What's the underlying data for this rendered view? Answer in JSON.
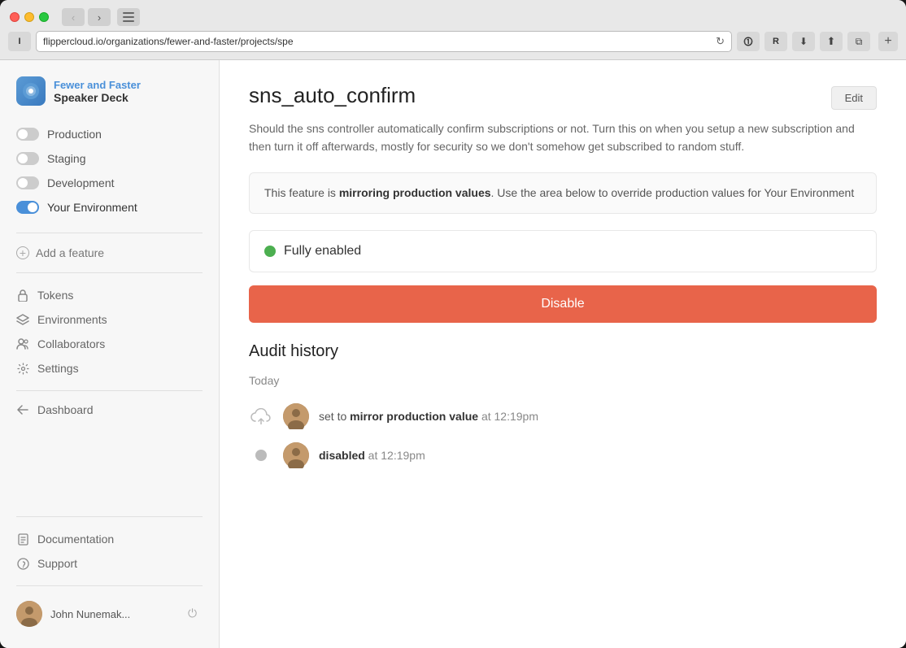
{
  "browser": {
    "url": "flippercloud.io/organizations/fewer-and-faster/projects/spe",
    "new_tab_label": "+"
  },
  "sidebar": {
    "brand": {
      "name": "Fewer and Faster",
      "sub": "Speaker Deck"
    },
    "environments": [
      {
        "label": "Production",
        "state": "off"
      },
      {
        "label": "Staging",
        "state": "off"
      },
      {
        "label": "Development",
        "state": "off"
      },
      {
        "label": "Your Environment",
        "state": "on",
        "active": true
      }
    ],
    "add_feature_label": "Add a feature",
    "nav_items": [
      {
        "label": "Tokens",
        "icon": "lock"
      },
      {
        "label": "Environments",
        "icon": "layers"
      },
      {
        "label": "Collaborators",
        "icon": "users"
      },
      {
        "label": "Settings",
        "icon": "gear"
      }
    ],
    "dashboard_label": "Dashboard",
    "footer": {
      "doc_label": "Documentation",
      "support_label": "Support"
    },
    "user": {
      "name": "John Nunemak...",
      "power_label": "⏻"
    }
  },
  "main": {
    "feature_name": "sns_auto_confirm",
    "feature_desc": "Should the sns controller automatically confirm subscriptions or not. Turn this on when you setup a new subscription and then turn it off afterwards, mostly for security so we don't somehow get subscribed to random stuff.",
    "edit_btn_label": "Edit",
    "mirror_notice": {
      "prefix": "This feature is ",
      "bold": "mirroring production values",
      "suffix": ". Use the area below to override production values for Your Environment"
    },
    "status": {
      "label": "Fully enabled",
      "color": "#4caf50"
    },
    "disable_btn_label": "Disable",
    "audit": {
      "title": "Audit history",
      "date_label": "Today",
      "entries": [
        {
          "icon": "cloud",
          "text_prefix": "set to ",
          "text_bold": "mirror production value",
          "text_suffix": " at 12:19pm"
        },
        {
          "icon": "dot",
          "text_prefix": "",
          "text_bold": "disabled",
          "text_suffix": " at 12:19pm"
        }
      ]
    }
  }
}
